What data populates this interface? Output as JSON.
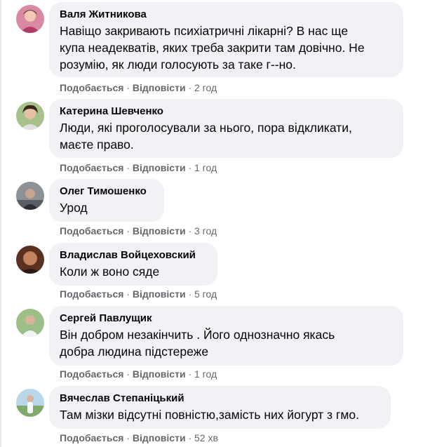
{
  "comments": [
    {
      "name": "Валя Житникова",
      "lines": [
        "Навіщо закривають психіатричні лікарні? В нас ще",
        "купа неадекватів, яких треба закрити там довічно. Не",
        "розумію, як люди голосують за таке г--но."
      ],
      "like": "Подобається",
      "sep1": "·",
      "reply": "Відповісти",
      "sep2": "·",
      "time": "2 год",
      "avatar_color": "#c9577a"
    },
    {
      "name": "Катерина Шевченко",
      "lines": [
        "Люди, які проголосували за нього, пора відкликати,",
        "маєте право."
      ],
      "like": "Подобається",
      "sep1": "·",
      "reply": "Відповісти",
      "sep2": "·",
      "time": "1 год",
      "avatar_color": "#7a9a5a"
    },
    {
      "name": "Олег Тимошенко",
      "lines": [
        "Урод"
      ],
      "like": "Подобається",
      "sep1": "·",
      "reply": "Відповісти",
      "sep2": "·",
      "time": "3 год",
      "avatar_color": "#4a4f56"
    },
    {
      "name": "Владислав Войцеховский",
      "lines": [
        "Коли ж воно сяде"
      ],
      "like": "Подобається",
      "sep1": "·",
      "reply": "Відповісти",
      "sep2": "·",
      "time": "5 год",
      "avatar_color": "#8a4a32"
    },
    {
      "name": "Сергей Павлущик",
      "lines": [
        "Він добром незакінчить . Його однозначно якась",
        "добра людина підстереже"
      ],
      "like": "Подобається",
      "sep1": "·",
      "reply": "Відповісти",
      "sep2": "·",
      "time": "1 год",
      "avatar_color": "#6b8f62"
    },
    {
      "name": "Вячеслав Степаніцький",
      "lines": [
        "Там мізки відсутні повністю,замість них йогурт з гмо."
      ],
      "like": "Подобається",
      "sep1": "·",
      "reply": "Відповісти",
      "sep2": "·",
      "time": "52 хв",
      "avatar_color": "#6fa3c8"
    }
  ]
}
